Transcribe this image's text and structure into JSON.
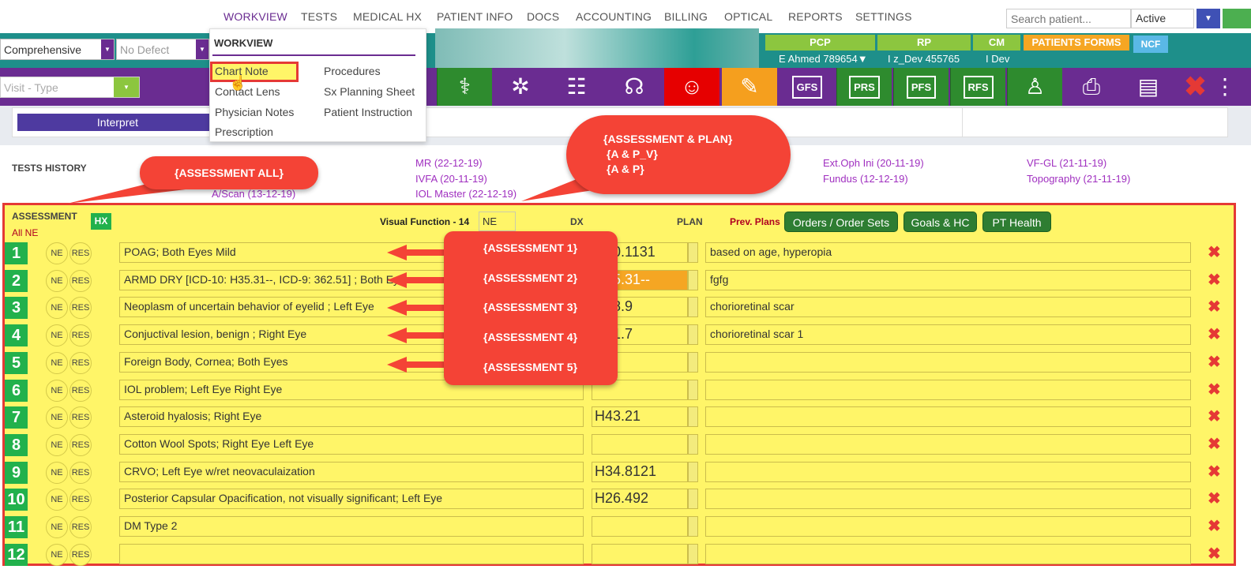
{
  "topnav": {
    "items": [
      "WORKVIEW",
      "TESTS",
      "MEDICAL HX",
      "PATIENT INFO",
      "DOCS",
      "ACCOUNTING",
      "BILLING",
      "OPTICAL",
      "REPORTS",
      "SETTINGS"
    ],
    "search_placeholder": "Search patient...",
    "status_value": "Active"
  },
  "filters": {
    "exam_type": "Comprehensive",
    "defect": "No Defect",
    "visit_type_placeholder": "Visit - Type"
  },
  "header_tabs": {
    "pcp_label": "PCP",
    "pcp_value": "E Ahmed 789654▼",
    "rp_label": "RP",
    "rp_value": "I z_Dev 455765",
    "cm_label": "CM",
    "cm_value": "I Dev",
    "patients_forms": "PATIENTS FORMS",
    "ncf": "NCF"
  },
  "toolbar": {
    "gfs": "GFS",
    "prs": "PRS",
    "pfs": "PFS",
    "rfs": "RFS"
  },
  "interpret_label": "Interpret",
  "tests_history": {
    "title": "TESTS HISTORY",
    "links": [
      "A/Scan (13-12-19)",
      "MR (22-12-19)",
      "IVFA (20-11-19)",
      "IOL Master (22-12-19)",
      "Ext.Oph Ini (20-11-19)",
      "Fundus (12-12-19)",
      "VF-GL (21-11-19)",
      "Topography (21-11-19)"
    ]
  },
  "assessment": {
    "title": "ASSESSMENT",
    "all_ne": "All NE",
    "hx": "HX",
    "visual_function": "Visual Function - 14",
    "ne_value": "NE",
    "dx_label": "DX",
    "plan_label": "PLAN",
    "prev_plans": "Prev. Plans",
    "orders_btn": "Orders / Order Sets",
    "goals_btn": "Goals & HC",
    "pt_health_btn": "PT Health",
    "ne_label": "NE",
    "res_label": "RES",
    "delete_glyph": "✖",
    "rows": [
      {
        "num": "1",
        "text": "POAG; Both Eyes Mild",
        "dx": "H40.1131",
        "plan": "based on age, hyperopia"
      },
      {
        "num": "2",
        "text": "ARMD DRY [ICD-10: H35.31--, ICD-9: 362.51] ; Both Eyes",
        "dx": "H35.31--",
        "plan": "fgfg"
      },
      {
        "num": "3",
        "text": "Neoplasm of uncertain behavior of eyelid ; Left Eye",
        "dx": "D48.9",
        "plan": "chorioretinal scar"
      },
      {
        "num": "4",
        "text": "Conjuctival lesion, benign ; Right Eye",
        "dx": "D31.7",
        "plan": "chorioretinal scar 1"
      },
      {
        "num": "5",
        "text": "Foreign Body, Cornea; Both Eyes",
        "dx": "",
        "plan": ""
      },
      {
        "num": "6",
        "text": "IOL problem; Left Eye Right Eye",
        "dx": "",
        "plan": ""
      },
      {
        "num": "7",
        "text": "Asteroid hyalosis; Right Eye",
        "dx": "H43.21",
        "plan": ""
      },
      {
        "num": "8",
        "text": "Cotton Wool Spots; Right Eye Left Eye",
        "dx": "",
        "plan": ""
      },
      {
        "num": "9",
        "text": "CRVO; Left Eye w/ret neovaculaization",
        "dx": "H34.8121",
        "plan": ""
      },
      {
        "num": "10",
        "text": "Posterior Capsular Opacification, not visually significant; Left Eye",
        "dx": "H26.492",
        "plan": ""
      },
      {
        "num": "11",
        "text": "DM Type 2",
        "dx": "",
        "plan": ""
      },
      {
        "num": "12",
        "text": "",
        "dx": "",
        "plan": ""
      }
    ]
  },
  "workview_menu": {
    "title": "WORKVIEW",
    "col1": [
      "Chart Note",
      "Contact Lens",
      "Physician Notes",
      "Prescription"
    ],
    "col2": [
      "Procedures",
      "Sx Planning Sheet",
      "Patient Instruction"
    ]
  },
  "callouts": {
    "assessment_all": "{ASSESSMENT ALL}",
    "ap_line1": "{ASSESSMENT & PLAN}",
    "ap_line2": "{A & P_V}",
    "ap_line3": "{A & P}",
    "a1": "{ASSESSMENT 1}",
    "a2": "{ASSESSMENT 2}",
    "a3": "{ASSESSMENT 3}",
    "a4": "{ASSESSMENT 4}",
    "a5": "{ASSESSMENT 5}"
  },
  "colors": {
    "purple": "#6a2c91",
    "teal": "#1e8f8a",
    "yellow": "#fff568",
    "green": "#22b14c",
    "red": "#e53935"
  }
}
